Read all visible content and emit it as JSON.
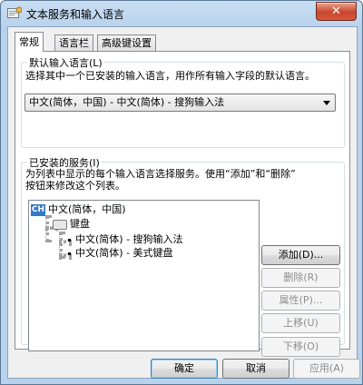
{
  "window": {
    "title": "文本服务和输入语言",
    "close_label": "✕"
  },
  "tabs": [
    {
      "label": "常规",
      "active": true
    },
    {
      "label": "语言栏",
      "active": false
    },
    {
      "label": "高级键设置",
      "active": false
    }
  ],
  "default_language": {
    "legend": "默认输入语言(L)",
    "description": "选择其中一个已安装的输入语言，用作所有输入字段的默认语言。",
    "selected": "中文(简体，中国) - 中文(简体) - 搜狗输入法"
  },
  "installed_services": {
    "legend": "已安装的服务(I)",
    "description_line1": "为列表中显示的每个输入语言选择服务。使用“添加”和“删除”",
    "description_line2": "按钮来修改这个列表。",
    "tree": {
      "language_badge": "CH",
      "language": "中文(简体，中国)",
      "category": "键盘",
      "items": [
        "中文(简体) - 搜狗输入法",
        "中文(简体) - 美式键盘"
      ]
    },
    "buttons": {
      "add": "添加(D)...",
      "remove": "删除(R)",
      "properties": "属性(P)...",
      "move_up": "上移(U)",
      "move_down": "下移(O)"
    }
  },
  "footer": {
    "ok": "确定",
    "cancel": "取消",
    "apply": "应用(A)"
  }
}
